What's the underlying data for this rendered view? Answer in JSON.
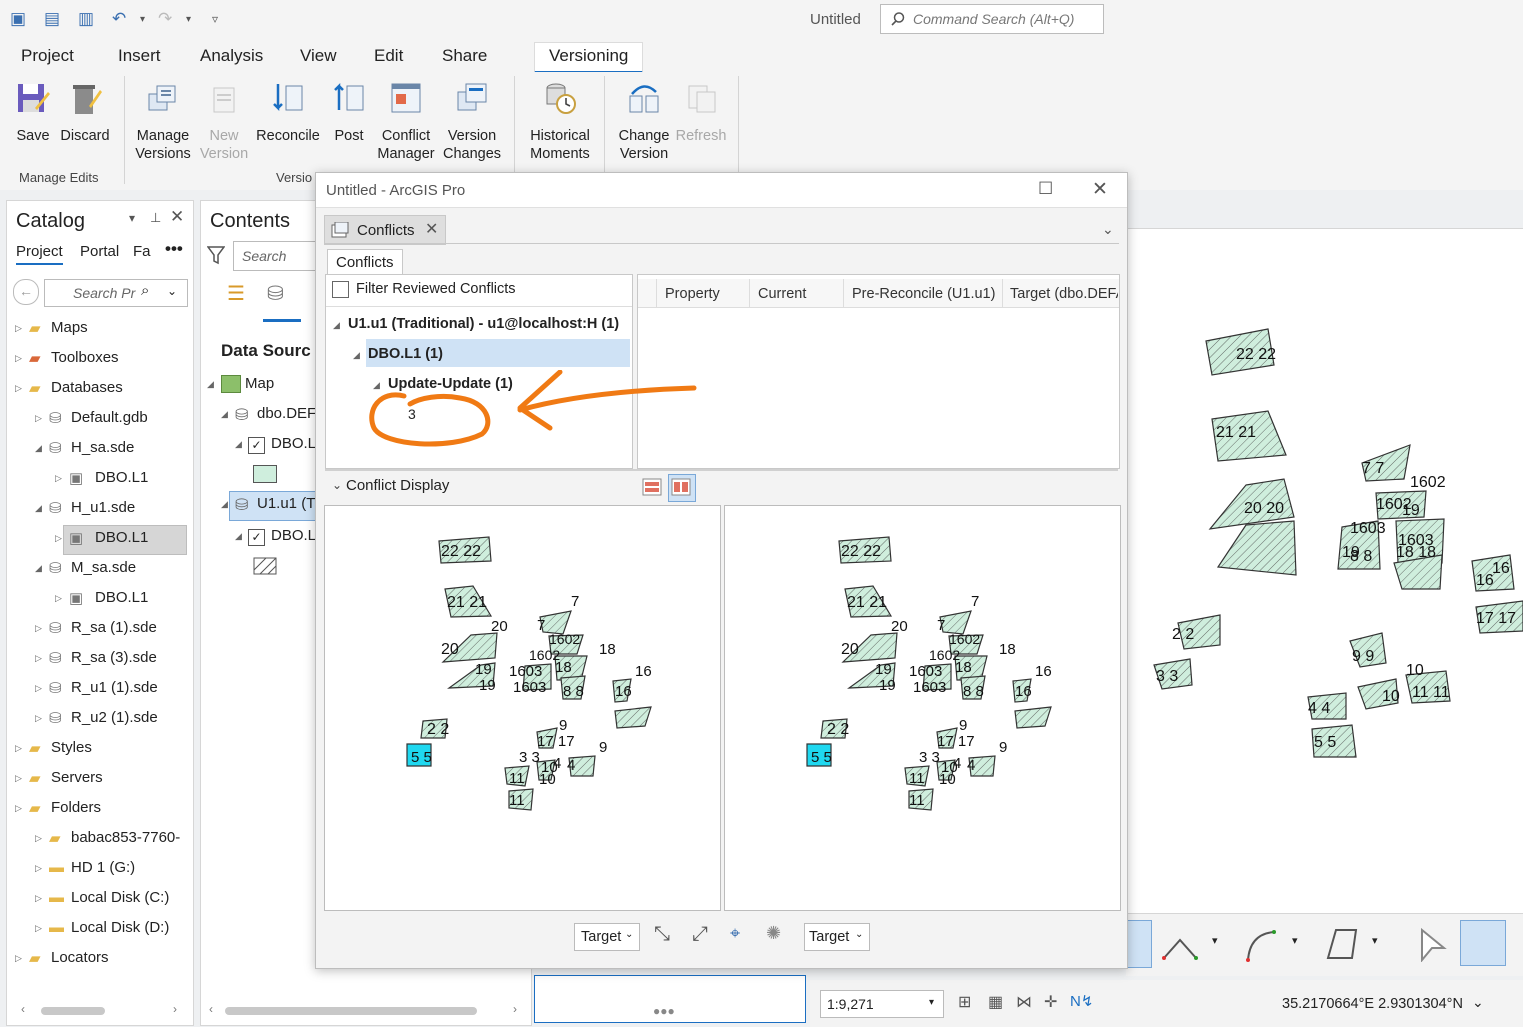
{
  "window": {
    "title": "Untitled",
    "command_search_placeholder": "Command Search (Alt+Q)"
  },
  "ribbon_tabs": [
    "Project",
    "Insert",
    "Analysis",
    "View",
    "Edit",
    "Share",
    "Versioning"
  ],
  "ribbon": {
    "save": "Save",
    "discard": "Discard",
    "manage_versions_1": "Manage",
    "manage_versions_2": "Versions",
    "new_version_1": "New",
    "new_version_2": "Version",
    "reconcile": "Reconcile",
    "post": "Post",
    "conflict_manager_1": "Conflict",
    "conflict_manager_2": "Manager",
    "version_changes_1": "Version",
    "version_changes_2": "Changes",
    "historical_moments_1": "Historical",
    "historical_moments_2": "Moments",
    "change_version_1": "Change",
    "change_version_2": "Version",
    "refresh": "Refresh",
    "group_manage_edits": "Manage Edits",
    "group_versioning": "Versio"
  },
  "catalog": {
    "title": "Catalog",
    "tabs": [
      "Project",
      "Portal",
      "Fa"
    ],
    "search_placeholder": "Search Pr",
    "items": [
      {
        "label": "Maps"
      },
      {
        "label": "Toolboxes"
      },
      {
        "label": "Databases"
      },
      {
        "label": "Default.gdb"
      },
      {
        "label": "H_sa.sde"
      },
      {
        "label": "DBO.L1"
      },
      {
        "label": "H_u1.sde"
      },
      {
        "label": "DBO.L1"
      },
      {
        "label": "M_sa.sde"
      },
      {
        "label": "DBO.L1"
      },
      {
        "label": "R_sa (1).sde"
      },
      {
        "label": "R_sa (3).sde"
      },
      {
        "label": "R_u1 (1).sde"
      },
      {
        "label": "R_u2 (1).sde"
      },
      {
        "label": "Styles"
      },
      {
        "label": "Servers"
      },
      {
        "label": "Folders"
      },
      {
        "label": "babac853-7760-"
      },
      {
        "label": "HD 1 (G:)"
      },
      {
        "label": "Local Disk (C:)"
      },
      {
        "label": "Local Disk (D:)"
      },
      {
        "label": "Locators"
      }
    ]
  },
  "contents": {
    "title": "Contents",
    "search_placeholder": "Search",
    "data_source": "Data Sourc",
    "map": "Map",
    "dbo_def": "dbo.DEF",
    "dbo_l1a": "DBO.L",
    "u1": "U1.u1 (Tr",
    "dbo_l1b": "DBO.L"
  },
  "dialog": {
    "title": "Untitled - ArcGIS Pro",
    "tab": "Conflicts",
    "subtab": "Conflicts",
    "filter_label": "Filter Reviewed Conflicts",
    "tree": {
      "root": "U1.u1 (Traditional) - u1@localhost:H (1)",
      "layer": "DBO.L1 (1)",
      "type": "Update-Update (1)",
      "oid": "3"
    },
    "columns": [
      "Property",
      "Current",
      "Pre-Reconcile (U1.u1)",
      "Target (dbo.DEFA"
    ],
    "conflict_display": "Conflict Display",
    "left_dropdown": "Target",
    "right_dropdown": "Target"
  },
  "map_labels": {
    "left": [
      "22 22",
      "21 21",
      "20",
      "7",
      "7",
      "20",
      "1602",
      "18",
      "1602",
      "19",
      "1603",
      "18",
      "16",
      "19",
      "1603",
      "8 8",
      "16",
      "2 2",
      "9",
      "17 17",
      "3 3",
      "9",
      "4",
      "11",
      "10",
      "4",
      "10",
      "11",
      "5 5"
    ],
    "right": [
      "22 22",
      "21 21",
      "7 7",
      "1602",
      "20 20",
      "1602",
      "1603",
      "19",
      "18 18",
      "19",
      "1603",
      "8 8",
      "16",
      "16",
      "2 2",
      "17 17",
      "9 9",
      "3 3",
      "10",
      "11 11",
      "4 4",
      "10",
      "5 5"
    ]
  },
  "statusbar": {
    "scale": "1:9,271",
    "coords": "35.2170664°E 2.9301304°N"
  },
  "colors": {
    "accent": "#1a6ec2",
    "feature_fill": "#cfeedd",
    "selected_feature": "#1fd8f0",
    "annotation": "#f07a14"
  }
}
